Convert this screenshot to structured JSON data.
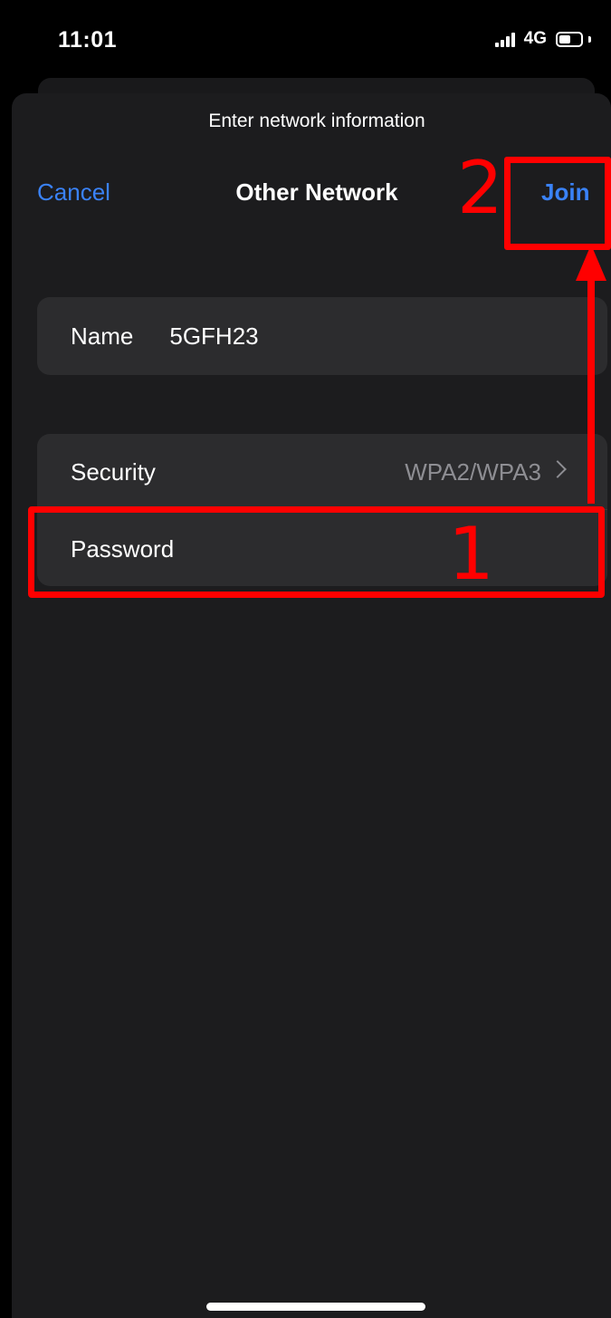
{
  "status_bar": {
    "time": "11:01",
    "network": "4G",
    "signal_icon": "signal-bars-icon",
    "battery_icon": "battery-icon",
    "battery_level": 0.55
  },
  "sheet": {
    "subtitle": "Enter network information",
    "title": "Other Network",
    "cancel_label": "Cancel",
    "join_label": "Join"
  },
  "form": {
    "name_label": "Name",
    "name_value": "5GFH23",
    "security_label": "Security",
    "security_value": "WPA2/WPA3",
    "password_placeholder": "Password"
  },
  "annotations": {
    "step1": "1",
    "step2": "2",
    "color": "#ff0000"
  },
  "colors": {
    "accent": "#3a82f7",
    "background": "#000000",
    "sheet": "#1c1c1e",
    "cell": "#2c2c2e",
    "secondary_text": "#8e8e93"
  }
}
